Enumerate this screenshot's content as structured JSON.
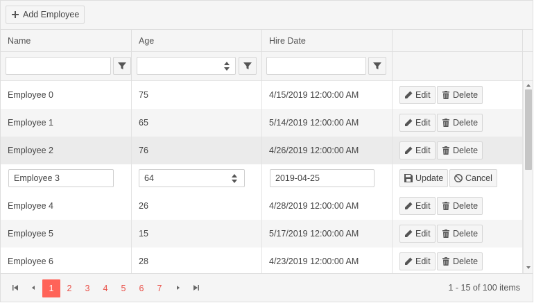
{
  "toolbar": {
    "add_label": "Add Employee"
  },
  "columns": {
    "name": "Name",
    "age": "Age",
    "hire_date": "Hire Date"
  },
  "rows": [
    {
      "name": "Employee 0",
      "age": "75",
      "hire_date": "4/15/2019 12:00:00 AM",
      "edit": "Edit",
      "delete": "Delete"
    },
    {
      "name": "Employee 1",
      "age": "65",
      "hire_date": "5/14/2019 12:00:00 AM",
      "edit": "Edit",
      "delete": "Delete"
    },
    {
      "name": "Employee 2",
      "age": "76",
      "hire_date": "4/26/2019 12:00:00 AM",
      "edit": "Edit",
      "delete": "Delete"
    },
    {
      "name": "Employee 3",
      "age": "64",
      "hire_date": "2019-04-25",
      "update": "Update",
      "cancel": "Cancel"
    },
    {
      "name": "Employee 4",
      "age": "26",
      "hire_date": "4/28/2019 12:00:00 AM",
      "edit": "Edit",
      "delete": "Delete"
    },
    {
      "name": "Employee 5",
      "age": "15",
      "hire_date": "5/17/2019 12:00:00 AM",
      "edit": "Edit",
      "delete": "Delete"
    },
    {
      "name": "Employee 6",
      "age": "28",
      "hire_date": "4/23/2019 12:00:00 AM",
      "edit": "Edit",
      "delete": "Delete"
    }
  ],
  "pager": {
    "pages": [
      "1",
      "2",
      "3",
      "4",
      "5",
      "6",
      "7"
    ],
    "current": "1",
    "info": "1 - 15 of 100 items"
  },
  "colors": {
    "accent": "#ff6358",
    "page_link": "#e9524a",
    "header_bg": "#f5f5f5",
    "border": "#dedede"
  },
  "icons": [
    "plus-icon",
    "filter-icon",
    "pencil-icon",
    "trash-icon",
    "save-icon",
    "cancel-icon",
    "first-page-icon",
    "prev-page-icon",
    "next-page-icon",
    "last-page-icon"
  ]
}
